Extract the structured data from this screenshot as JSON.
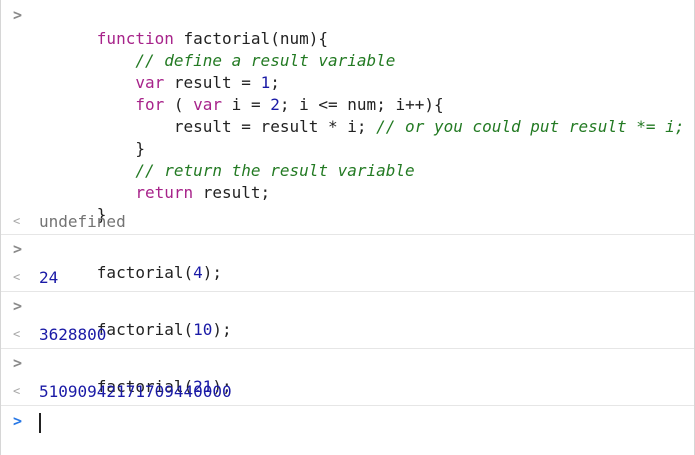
{
  "console": {
    "prompt_symbol": ">",
    "result_symbol": "<",
    "entries": [
      {
        "type": "input",
        "lines": [
          [
            {
              "t": "kw",
              "v": "function"
            },
            {
              "t": "fn",
              "v": " factorial(num){"
            }
          ],
          [
            {
              "t": "cm",
              "v": "    // define a result variable"
            }
          ],
          [
            {
              "t": "kw",
              "v": "    var"
            },
            {
              "t": "fn",
              "v": " result = "
            },
            {
              "t": "num",
              "v": "1"
            },
            {
              "t": "fn",
              "v": ";"
            }
          ],
          [
            {
              "t": "kw",
              "v": "    for"
            },
            {
              "t": "fn",
              "v": " ( "
            },
            {
              "t": "kw",
              "v": "var"
            },
            {
              "t": "fn",
              "v": " i = "
            },
            {
              "t": "num",
              "v": "2"
            },
            {
              "t": "fn",
              "v": "; i <= num; i++){"
            }
          ],
          [
            {
              "t": "fn",
              "v": "        result = result * i; "
            },
            {
              "t": "cm",
              "v": "// or you could put result *= i;"
            }
          ],
          [
            {
              "t": "fn",
              "v": "    }"
            }
          ],
          [
            {
              "t": "cm",
              "v": "    // return the result variable"
            }
          ],
          [
            {
              "t": "kw",
              "v": "    return"
            },
            {
              "t": "fn",
              "v": " result;"
            }
          ],
          [
            {
              "t": "fn",
              "v": "}"
            }
          ]
        ]
      },
      {
        "type": "output",
        "text": "undefined",
        "style": "undef"
      },
      {
        "type": "input",
        "lines": [
          [
            {
              "t": "fn",
              "v": "factorial("
            },
            {
              "t": "num",
              "v": "4"
            },
            {
              "t": "fn",
              "v": ");"
            }
          ]
        ]
      },
      {
        "type": "output",
        "text": "24",
        "style": "outnum"
      },
      {
        "type": "input",
        "lines": [
          [
            {
              "t": "fn",
              "v": "factorial("
            },
            {
              "t": "num",
              "v": "10"
            },
            {
              "t": "fn",
              "v": ");"
            }
          ]
        ]
      },
      {
        "type": "output",
        "text": "3628800",
        "style": "outnum"
      },
      {
        "type": "input",
        "lines": [
          [
            {
              "t": "fn",
              "v": "factorial("
            },
            {
              "t": "num",
              "v": "21"
            },
            {
              "t": "fn",
              "v": ");"
            }
          ]
        ]
      },
      {
        "type": "output",
        "text": "51090942171709440000",
        "style": "outnum"
      }
    ],
    "active_input": ""
  }
}
